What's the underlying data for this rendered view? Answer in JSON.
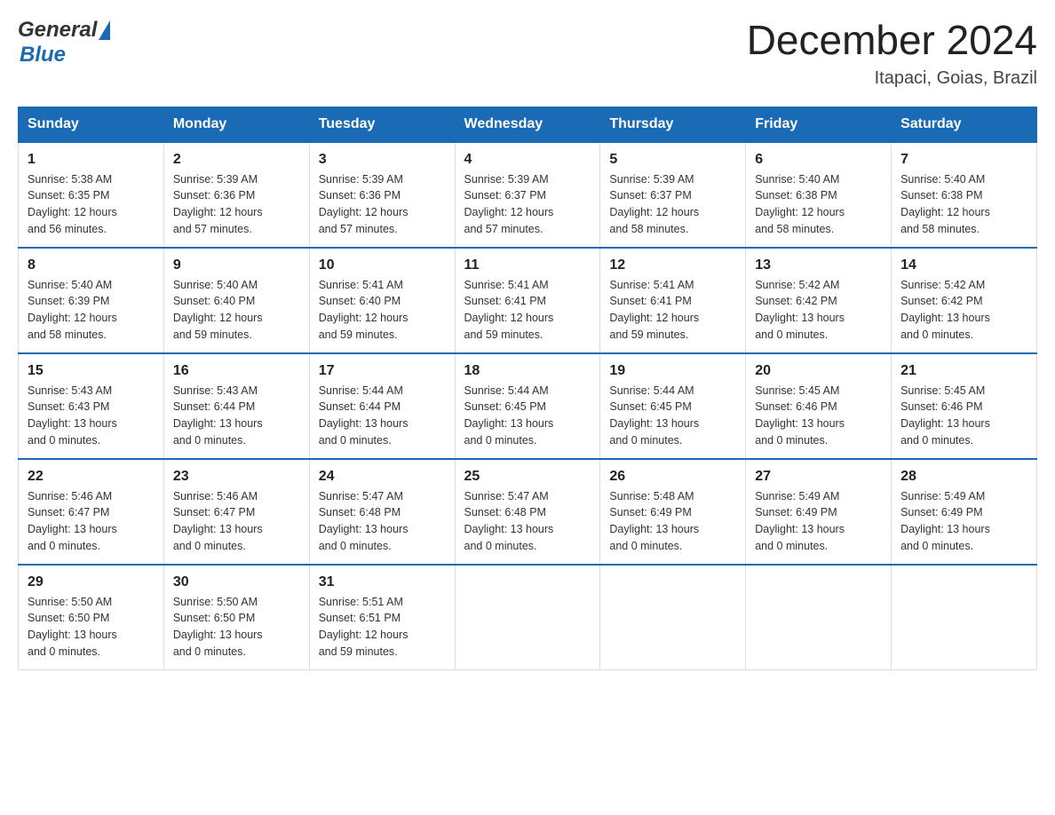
{
  "header": {
    "logo_general": "General",
    "logo_blue": "Blue",
    "month_year": "December 2024",
    "location": "Itapaci, Goias, Brazil"
  },
  "days_of_week": [
    "Sunday",
    "Monday",
    "Tuesday",
    "Wednesday",
    "Thursday",
    "Friday",
    "Saturday"
  ],
  "weeks": [
    [
      {
        "day": "1",
        "sunrise": "5:38 AM",
        "sunset": "6:35 PM",
        "daylight": "12 hours and 56 minutes."
      },
      {
        "day": "2",
        "sunrise": "5:39 AM",
        "sunset": "6:36 PM",
        "daylight": "12 hours and 57 minutes."
      },
      {
        "day": "3",
        "sunrise": "5:39 AM",
        "sunset": "6:36 PM",
        "daylight": "12 hours and 57 minutes."
      },
      {
        "day": "4",
        "sunrise": "5:39 AM",
        "sunset": "6:37 PM",
        "daylight": "12 hours and 57 minutes."
      },
      {
        "day": "5",
        "sunrise": "5:39 AM",
        "sunset": "6:37 PM",
        "daylight": "12 hours and 58 minutes."
      },
      {
        "day": "6",
        "sunrise": "5:40 AM",
        "sunset": "6:38 PM",
        "daylight": "12 hours and 58 minutes."
      },
      {
        "day": "7",
        "sunrise": "5:40 AM",
        "sunset": "6:38 PM",
        "daylight": "12 hours and 58 minutes."
      }
    ],
    [
      {
        "day": "8",
        "sunrise": "5:40 AM",
        "sunset": "6:39 PM",
        "daylight": "12 hours and 58 minutes."
      },
      {
        "day": "9",
        "sunrise": "5:40 AM",
        "sunset": "6:40 PM",
        "daylight": "12 hours and 59 minutes."
      },
      {
        "day": "10",
        "sunrise": "5:41 AM",
        "sunset": "6:40 PM",
        "daylight": "12 hours and 59 minutes."
      },
      {
        "day": "11",
        "sunrise": "5:41 AM",
        "sunset": "6:41 PM",
        "daylight": "12 hours and 59 minutes."
      },
      {
        "day": "12",
        "sunrise": "5:41 AM",
        "sunset": "6:41 PM",
        "daylight": "12 hours and 59 minutes."
      },
      {
        "day": "13",
        "sunrise": "5:42 AM",
        "sunset": "6:42 PM",
        "daylight": "13 hours and 0 minutes."
      },
      {
        "day": "14",
        "sunrise": "5:42 AM",
        "sunset": "6:42 PM",
        "daylight": "13 hours and 0 minutes."
      }
    ],
    [
      {
        "day": "15",
        "sunrise": "5:43 AM",
        "sunset": "6:43 PM",
        "daylight": "13 hours and 0 minutes."
      },
      {
        "day": "16",
        "sunrise": "5:43 AM",
        "sunset": "6:44 PM",
        "daylight": "13 hours and 0 minutes."
      },
      {
        "day": "17",
        "sunrise": "5:44 AM",
        "sunset": "6:44 PM",
        "daylight": "13 hours and 0 minutes."
      },
      {
        "day": "18",
        "sunrise": "5:44 AM",
        "sunset": "6:45 PM",
        "daylight": "13 hours and 0 minutes."
      },
      {
        "day": "19",
        "sunrise": "5:44 AM",
        "sunset": "6:45 PM",
        "daylight": "13 hours and 0 minutes."
      },
      {
        "day": "20",
        "sunrise": "5:45 AM",
        "sunset": "6:46 PM",
        "daylight": "13 hours and 0 minutes."
      },
      {
        "day": "21",
        "sunrise": "5:45 AM",
        "sunset": "6:46 PM",
        "daylight": "13 hours and 0 minutes."
      }
    ],
    [
      {
        "day": "22",
        "sunrise": "5:46 AM",
        "sunset": "6:47 PM",
        "daylight": "13 hours and 0 minutes."
      },
      {
        "day": "23",
        "sunrise": "5:46 AM",
        "sunset": "6:47 PM",
        "daylight": "13 hours and 0 minutes."
      },
      {
        "day": "24",
        "sunrise": "5:47 AM",
        "sunset": "6:48 PM",
        "daylight": "13 hours and 0 minutes."
      },
      {
        "day": "25",
        "sunrise": "5:47 AM",
        "sunset": "6:48 PM",
        "daylight": "13 hours and 0 minutes."
      },
      {
        "day": "26",
        "sunrise": "5:48 AM",
        "sunset": "6:49 PM",
        "daylight": "13 hours and 0 minutes."
      },
      {
        "day": "27",
        "sunrise": "5:49 AM",
        "sunset": "6:49 PM",
        "daylight": "13 hours and 0 minutes."
      },
      {
        "day": "28",
        "sunrise": "5:49 AM",
        "sunset": "6:49 PM",
        "daylight": "13 hours and 0 minutes."
      }
    ],
    [
      {
        "day": "29",
        "sunrise": "5:50 AM",
        "sunset": "6:50 PM",
        "daylight": "13 hours and 0 minutes."
      },
      {
        "day": "30",
        "sunrise": "5:50 AM",
        "sunset": "6:50 PM",
        "daylight": "13 hours and 0 minutes."
      },
      {
        "day": "31",
        "sunrise": "5:51 AM",
        "sunset": "6:51 PM",
        "daylight": "12 hours and 59 minutes."
      },
      null,
      null,
      null,
      null
    ]
  ],
  "labels": {
    "sunrise_prefix": "Sunrise: ",
    "sunset_prefix": "Sunset: ",
    "daylight_prefix": "Daylight: "
  }
}
